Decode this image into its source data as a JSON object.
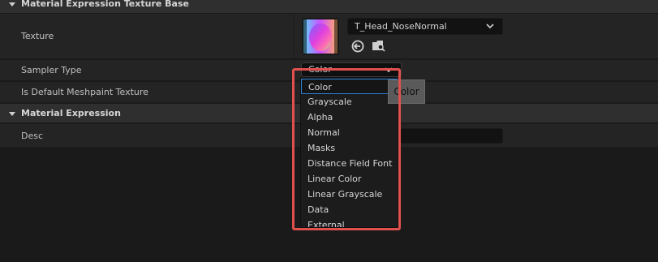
{
  "sections": {
    "texture_base": {
      "title": "Material Expression Texture Base"
    },
    "material_expression": {
      "title": "Material Expression"
    }
  },
  "rows": {
    "texture_label": "Texture",
    "sampler_type_label": "Sampler Type",
    "meshpaint_label": "Is Default Meshpaint Texture",
    "desc_label": "Desc"
  },
  "texture": {
    "asset_name": "T_Head_NoseNormal"
  },
  "sampler": {
    "value": "Color",
    "options": [
      "Color",
      "Grayscale",
      "Alpha",
      "Normal",
      "Masks",
      "Distance Field Font",
      "Linear Color",
      "Linear Grayscale",
      "Data",
      "External"
    ]
  },
  "tooltip": {
    "text": "Color"
  },
  "colors": {
    "highlight": "#e0504f",
    "selection": "#2b80d6"
  },
  "icons": [
    "chevron-down-icon",
    "use-selected-asset-icon",
    "browse-asset-icon"
  ]
}
